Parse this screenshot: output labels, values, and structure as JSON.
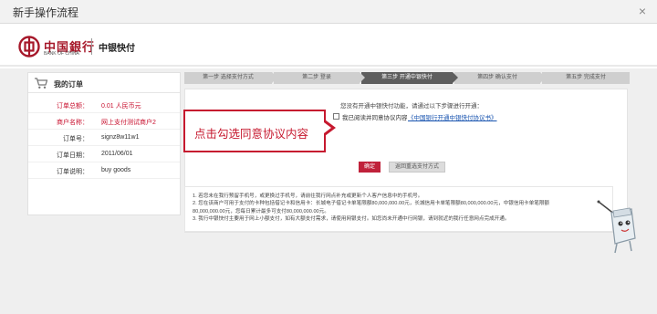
{
  "dialog": {
    "title": "新手操作流程",
    "close_glyph": "×"
  },
  "bank": {
    "name_zh": "中国銀行",
    "name_en": "BANK OF CHINA",
    "service": "中银快付",
    "brand_color": "#a6182a"
  },
  "order": {
    "title": "我的订单",
    "rows": [
      {
        "label": "订单总额：",
        "value": "0.01 人民币元",
        "highlight": true
      },
      {
        "label": "商户名称：",
        "value": "网上支付测试商户2",
        "highlight": true
      },
      {
        "label": "订单号：",
        "value": "signz8w11w1",
        "highlight": false
      },
      {
        "label": "订单日期：",
        "value": "2011/06/01",
        "highlight": false
      },
      {
        "label": "订单说明：",
        "value": "buy goods",
        "highlight": false
      }
    ]
  },
  "steps": [
    {
      "label": "第一步  选择支付方式",
      "active": false
    },
    {
      "label": "第二步  登录",
      "active": false
    },
    {
      "label": "第三步  开通中银快付",
      "active": true
    },
    {
      "label": "第四步  确认支付",
      "active": false
    },
    {
      "label": "第五步  完成支付",
      "active": false
    }
  ],
  "main": {
    "prompt": "您没有开通中银快付功能，请通过以下步骤进行开通：",
    "agree_label": "我已阅读并同意协议内容",
    "agree_link": "《中国银行开通中银快付协议书》",
    "agree_checked": false,
    "confirm_button": "确定",
    "return_button": "返回重选支付方式"
  },
  "callout": {
    "text": "点击勾选同意协议内容",
    "color": "#c6192f"
  },
  "notes": [
    "1. 若您未在我行预留手机号，或更换过手机号，请前往我行网点补充或更新个人客户信息中的手机号。",
    "2. 您在该商户可用于支付的卡种包括借记卡和信用卡：长城电子借记卡单笔限额80,000,000.00元，长城信用卡单笔限额80,000,000.00元，中银信用卡单笔限额",
    "   80,000,000.00元，您每日累计最多可支付80,000,000.00元。",
    "3. 我行中银快付主要用于网上小额支付，如有大额支付需求，请使用网银支付。如您尚未开通中行网银，请到就近的我行任意网点完成开通。"
  ],
  "icons": {
    "logo": "boc-logo-icon",
    "cart": "shopping-cart-icon",
    "mascot": "mascot-pointer-icon"
  }
}
